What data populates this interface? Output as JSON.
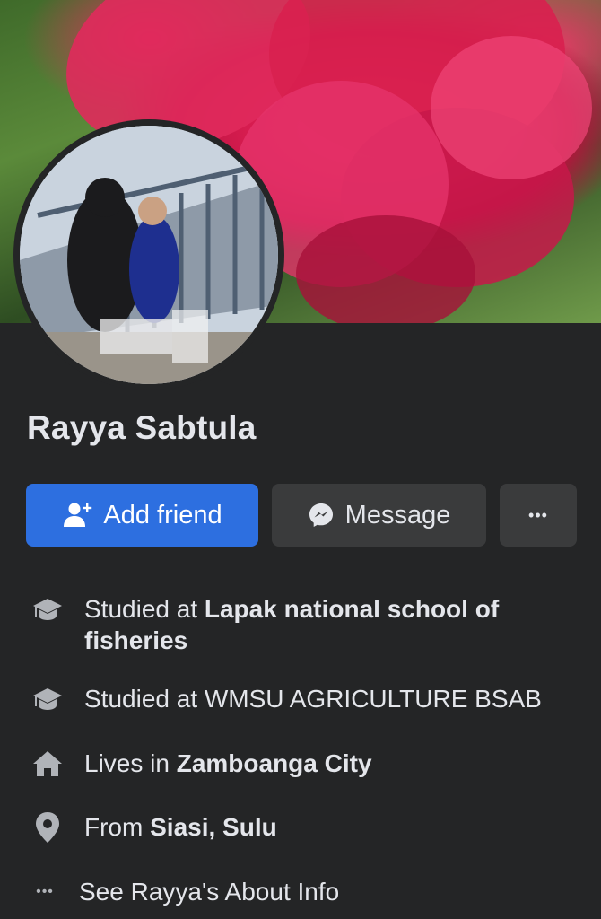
{
  "profile": {
    "name": "Rayya Sabtula"
  },
  "actions": {
    "add_friend": "Add friend",
    "message": "Message",
    "more": "•••"
  },
  "intro": [
    {
      "icon": "graduation-cap-icon",
      "prefix": "Studied at ",
      "value": "Lapak national school of fisheries",
      "bold": true
    },
    {
      "icon": "graduation-cap-icon",
      "prefix": "Studied at ",
      "value": "WMSU AGRICULTURE BSAB",
      "bold": false
    },
    {
      "icon": "home-icon",
      "prefix": "Lives in ",
      "value": "Zamboanga City",
      "bold": true
    },
    {
      "icon": "location-pin-icon",
      "prefix": "From ",
      "value": "Siasi, Sulu",
      "bold": true
    }
  ],
  "see_about": "See Rayya's About Info",
  "colors": {
    "background": "#242526",
    "primary_button": "#2d6fe0",
    "secondary_button": "#3a3b3c",
    "text": "#e4e6eb"
  }
}
